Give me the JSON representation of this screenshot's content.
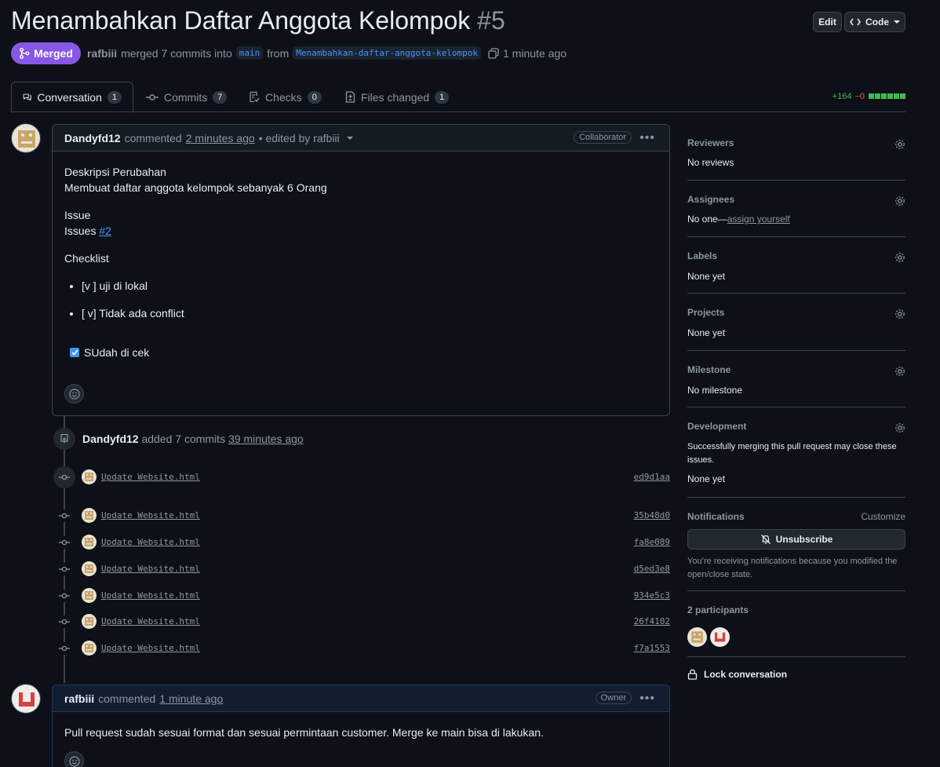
{
  "pr": {
    "title": "Menambahkan Daftar Anggota Kelompok",
    "number": "#5",
    "state": "Merged",
    "author": "rafbiii",
    "merge_text": "merged 7 commits into",
    "base_branch": "main",
    "from_text": "from",
    "head_branch": "Menambahkan-daftar-anggota-kelompok",
    "time": "1 minute ago"
  },
  "header": {
    "edit_label": "Edit",
    "code_label": "Code"
  },
  "tabs": [
    {
      "label": "Conversation",
      "count": "1"
    },
    {
      "label": "Commits",
      "count": "7"
    },
    {
      "label": "Checks",
      "count": "0"
    },
    {
      "label": "Files changed",
      "count": "1"
    }
  ],
  "diffstat": {
    "additions": "+164",
    "deletions": "−0"
  },
  "comment1": {
    "author": "Dandyfd12",
    "action": "commented",
    "time": "2 minutes ago",
    "edited": "• edited by rafbiii",
    "role": "Collaborator",
    "line1": "Deskripsi Perubahan",
    "line2": "Membuat daftar anggota kelompok sebanyak 6 Orang",
    "issue_heading": "Issue",
    "issues_prefix": "Issues",
    "issue_link": "#2",
    "checklist_heading": "Checklist",
    "item1": "[v ] uji di lokal",
    "item2": "[ v] Tidak ada conflict",
    "checkbox_label": "SUdah di cek"
  },
  "commits_event": {
    "author": "Dandyfd12",
    "action": "added 7 commits",
    "time": "39 minutes ago"
  },
  "commits": [
    {
      "message": "Update Website.html",
      "sha": "ed9d1aa"
    },
    {
      "message": "Update Website.html",
      "sha": "35b48d0"
    },
    {
      "message": "Update Website.html",
      "sha": "fa8e089"
    },
    {
      "message": "Update Website.html",
      "sha": "d5ed3e8"
    },
    {
      "message": "Update Website.html",
      "sha": "934e5c3"
    },
    {
      "message": "Update Website.html",
      "sha": "26f4102"
    },
    {
      "message": "Update Website.html",
      "sha": "f7a1553"
    }
  ],
  "comment2": {
    "author": "rafbiii",
    "action": "commented",
    "time": "1 minute ago",
    "role": "Owner",
    "body": "Pull request sudah sesuai format dan sesuai permintaan customer. Merge ke main bisa di lakukan."
  },
  "sidebar": {
    "reviewers_label": "Reviewers",
    "reviewers_value": "No reviews",
    "assignees_label": "Assignees",
    "assignees_value": "No one—",
    "assign_yourself": "assign yourself",
    "labels_label": "Labels",
    "labels_value": "None yet",
    "projects_label": "Projects",
    "projects_value": "None yet",
    "milestone_label": "Milestone",
    "milestone_value": "No milestone",
    "development_label": "Development",
    "development_text": "Successfully merging this pull request may close these issues.",
    "development_value": "None yet",
    "notifications_label": "Notifications",
    "customize_label": "Customize",
    "unsubscribe_label": "Unsubscribe",
    "notify_reason": "You’re receiving notifications because you modified the open/close state.",
    "participants_label": "2 participants",
    "lock_label": "Lock conversation"
  },
  "colors": {
    "merged": "#8957e5",
    "accent_link": "#4493f8",
    "additions": "#3fb950",
    "deletions": "#f85149"
  }
}
